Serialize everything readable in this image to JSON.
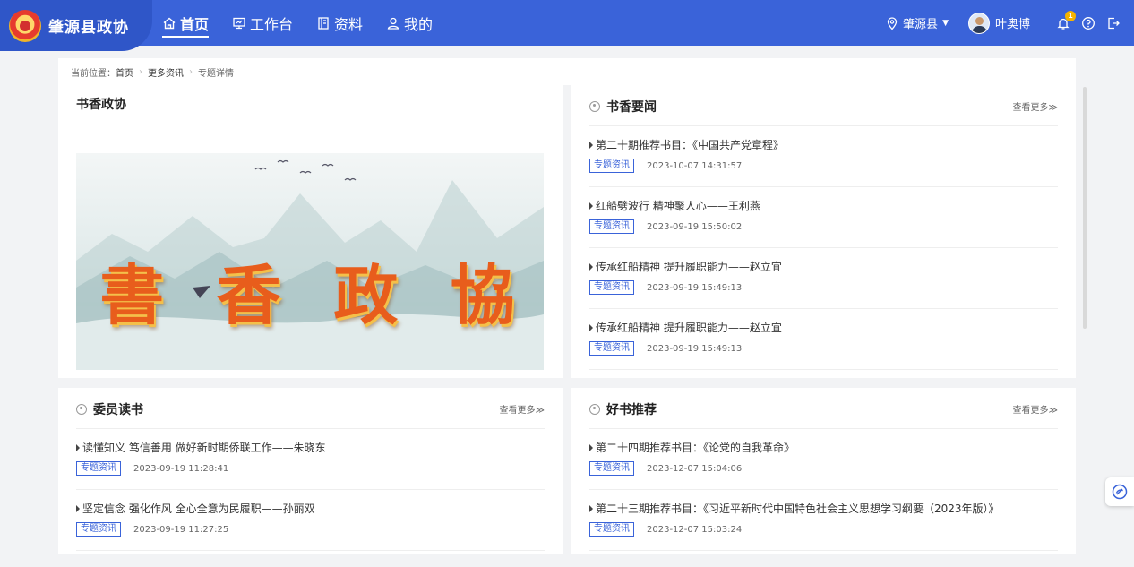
{
  "header": {
    "brand": "肇源县政协",
    "nav": [
      {
        "label": "首页",
        "icon": "home-icon",
        "active": true
      },
      {
        "label": "工作台",
        "icon": "monitor-icon",
        "active": false
      },
      {
        "label": "资料",
        "icon": "document-icon",
        "active": false
      },
      {
        "label": "我的",
        "icon": "user-icon",
        "active": false
      }
    ],
    "county": "肇源县",
    "user_name": "叶奥博",
    "notification_count": "1",
    "colors": {
      "bar": "#3a63d9",
      "brand_bg": "#2f56c8"
    }
  },
  "breadcrumb": {
    "prefix": "当前位置：",
    "items": [
      "首页",
      "更多资讯",
      "专题详情"
    ]
  },
  "feature": {
    "title": "书香政协",
    "banner_chars": [
      "書",
      "香",
      "政",
      "協"
    ]
  },
  "sections": {
    "news": {
      "title": "书香要闻",
      "more": "查看更多≫",
      "items": [
        {
          "title": "第二十期推荐书目：《中国共产党章程》",
          "tag": "专题资讯",
          "time": "2023-10-07 14:31:57"
        },
        {
          "title": "红船劈波行 精神聚人心——王利燕",
          "tag": "专题资讯",
          "time": "2023-09-19 15:50:02"
        },
        {
          "title": "传承红船精神 提升履职能力——赵立宜",
          "tag": "专题资讯",
          "time": "2023-09-19 15:49:13"
        },
        {
          "title": "传承红船精神 提升履职能力——赵立宜",
          "tag": "专题资讯",
          "time": "2023-09-19 15:49:13"
        }
      ]
    },
    "reading": {
      "title": "委员读书",
      "more": "查看更多≫",
      "items": [
        {
          "title": "读懂知义 笃信善用 做好新时期侨联工作——朱晓东",
          "tag": "专题资讯",
          "time": "2023-09-19 11:28:41"
        },
        {
          "title": "坚定信念 强化作风 全心全意为民履职——孙丽双",
          "tag": "专题资讯",
          "time": "2023-09-19 11:27:25"
        }
      ]
    },
    "recommend": {
      "title": "好书推荐",
      "more": "查看更多≫",
      "items": [
        {
          "title": "第二十四期推荐书目：《论党的自我革命》",
          "tag": "专题资讯",
          "time": "2023-12-07 15:04:06"
        },
        {
          "title": "第二十三期推荐书目：《习近平新时代中国特色社会主义思想学习纲要（2023年版）》",
          "tag": "专题资讯",
          "time": "2023-12-07 15:03:24"
        }
      ]
    }
  }
}
